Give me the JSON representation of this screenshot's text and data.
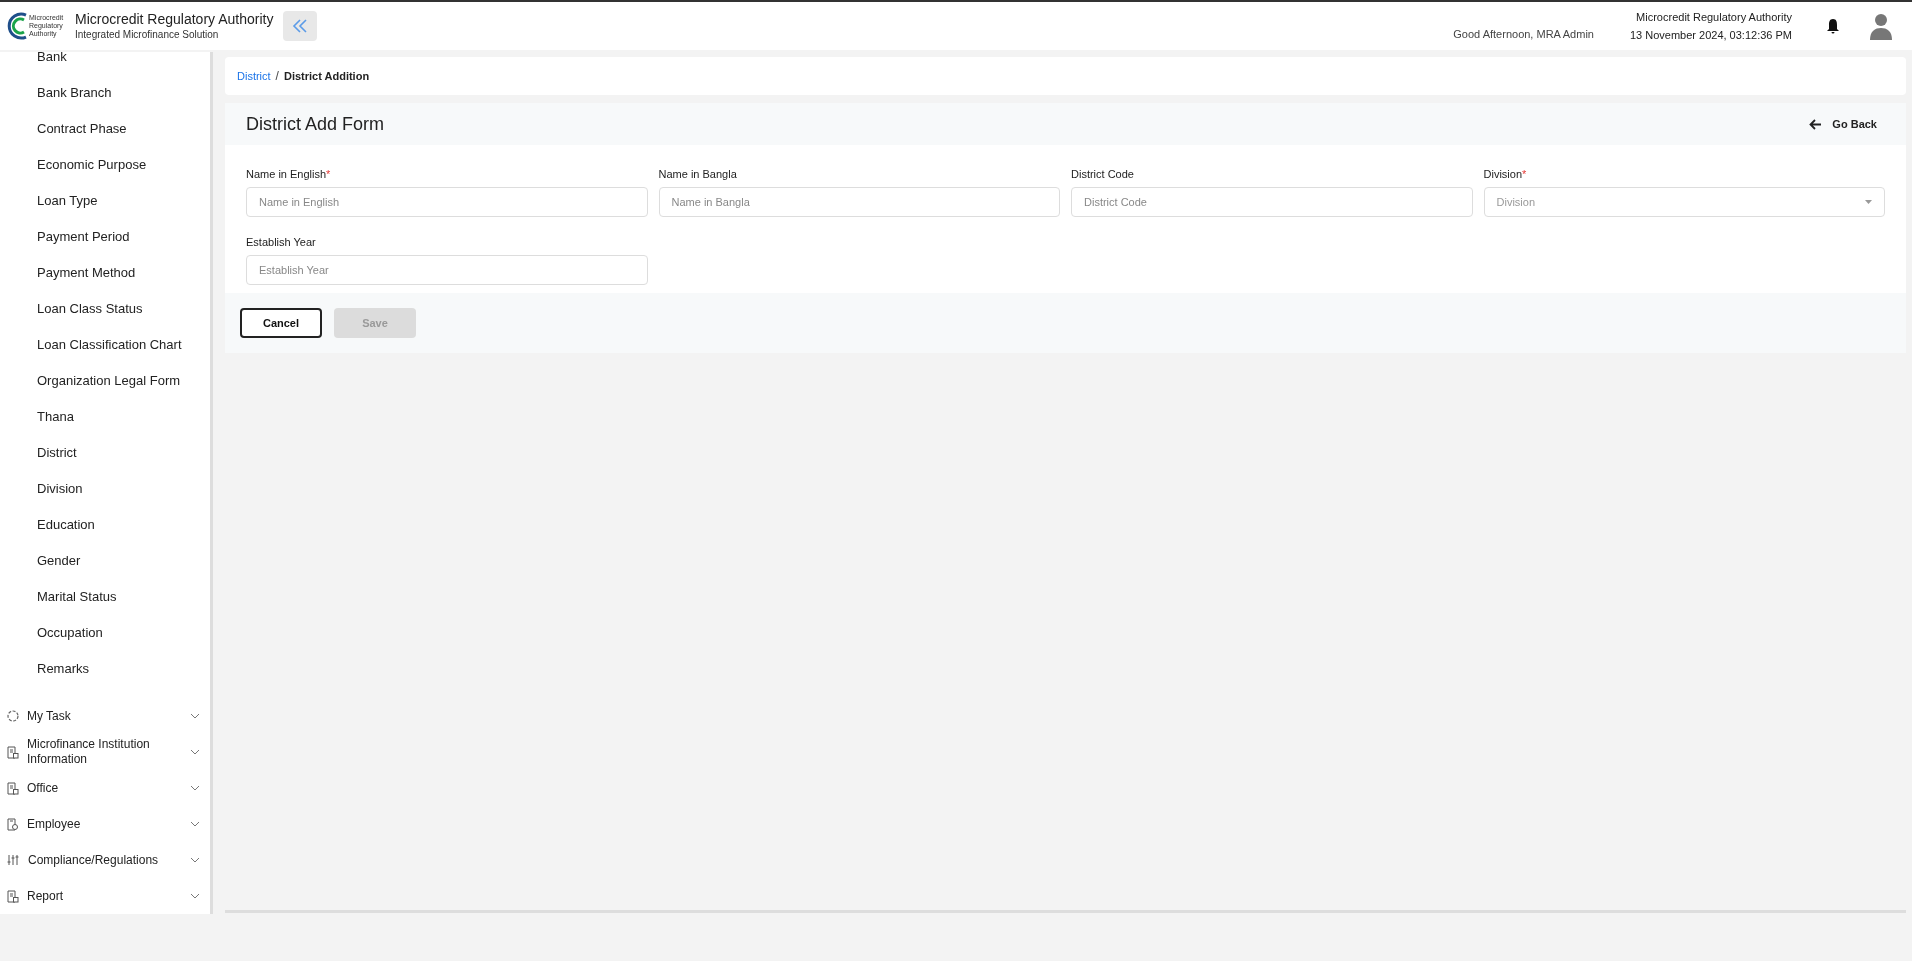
{
  "header": {
    "org_title": "Microcredit Regulatory Authority",
    "org_subtitle": "Integrated Microfinance Solution",
    "logo_text": "Microcredit Regulatory Authority",
    "greeting": "Good Afternoon, MRA Admin",
    "right_title": "Microcredit Regulatory Authority",
    "datetime": "13 November 2024, 03:12:36 PM"
  },
  "sidebar": {
    "sub_items": [
      {
        "label": "Bank",
        "selected": false
      },
      {
        "label": "Bank Branch",
        "selected": false
      },
      {
        "label": "Contract Phase",
        "selected": false
      },
      {
        "label": "Economic Purpose",
        "selected": false
      },
      {
        "label": "Loan Type",
        "selected": false
      },
      {
        "label": "Payment Period",
        "selected": false
      },
      {
        "label": "Payment Method",
        "selected": false
      },
      {
        "label": "Loan Class Status",
        "selected": false
      },
      {
        "label": "Loan Classification Chart",
        "selected": false
      },
      {
        "label": "Organization Legal Form",
        "selected": false
      },
      {
        "label": "Thana",
        "selected": false
      },
      {
        "label": "District",
        "selected": false
      },
      {
        "label": "Division",
        "selected": false
      },
      {
        "label": "Education",
        "selected": false
      },
      {
        "label": "Gender",
        "selected": false
      },
      {
        "label": "Marital Status",
        "selected": false
      },
      {
        "label": "Occupation",
        "selected": false
      },
      {
        "label": "Remarks",
        "selected": false
      }
    ],
    "groups": [
      {
        "label": "My Task",
        "kind": "task",
        "expanded": false
      },
      {
        "label": "Microfinance Institution Information",
        "kind": "document",
        "expanded": false
      },
      {
        "label": "Office",
        "kind": "document",
        "expanded": false
      },
      {
        "label": "Employee",
        "kind": "badge",
        "expanded": false
      },
      {
        "label": "Compliance/Regulations",
        "kind": "sliders",
        "expanded": false
      },
      {
        "label": "Report",
        "kind": "document",
        "expanded": false
      }
    ]
  },
  "breadcrumb": [
    {
      "label": "District",
      "kind": "link"
    },
    {
      "label": "/",
      "kind": "separator"
    },
    {
      "label": "District Addition",
      "kind": "current"
    }
  ],
  "form": {
    "title": "District Add Form",
    "go_back": "Go Back",
    "fields": [
      {
        "label": "Name in English",
        "required_mark": "*",
        "kind": "text",
        "placeholder": "Name in English"
      },
      {
        "label": "Name in Bangla",
        "kind": "text",
        "placeholder": "Name in Bangla"
      },
      {
        "label": "District Code",
        "kind": "text",
        "placeholder": "District Code"
      },
      {
        "label": "Division",
        "required_mark": "*",
        "kind": "select",
        "placeholder": "Division"
      },
      {
        "label": "Establish Year",
        "kind": "text",
        "placeholder": "Establish Year"
      }
    ],
    "buttons": [
      {
        "label": "Cancel",
        "kind": "outline",
        "disabled": false
      },
      {
        "label": "Save",
        "kind": "primary",
        "disabled": true
      }
    ]
  }
}
